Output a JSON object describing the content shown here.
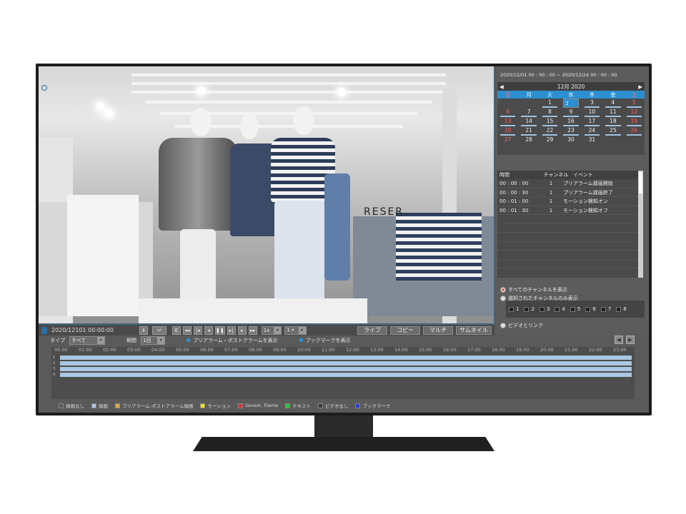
{
  "playback": {
    "datetime": "2020/12101  00:00:00",
    "speed": "1x",
    "step": "1 ⏸",
    "e_label": "E",
    "buttons": [
      "ライブ",
      "コピー",
      "マルチ",
      "サムネイル"
    ]
  },
  "video": {
    "store_sign": "RESER"
  },
  "search_range": "2020/12/01  00 : 00 : 00 ~ 2020/12/24  00 : 00 : 00",
  "calendar": {
    "month_label": "12月  2020",
    "weekdays": [
      "日",
      "月",
      "火",
      "水",
      "木",
      "金",
      "土"
    ],
    "weeks": [
      [
        "",
        "",
        "1",
        "2",
        "3",
        "4",
        "5"
      ],
      [
        "6",
        "7",
        "8",
        "9",
        "10",
        "11",
        "12"
      ],
      [
        "13",
        "14",
        "15",
        "16",
        "17",
        "18",
        "19"
      ],
      [
        "20",
        "21",
        "22",
        "23",
        "24",
        "25",
        "26"
      ],
      [
        "27",
        "28",
        "29",
        "30",
        "31",
        "",
        ""
      ]
    ],
    "selected_day": "2"
  },
  "events": {
    "headers": [
      "時間",
      "チャンネル",
      "イベント"
    ],
    "rows": [
      [
        "00 : 00 : 00",
        "1",
        "プリアラーム録画開始"
      ],
      [
        "00 : 00 : 30",
        "1",
        "プリアラーム録画終了"
      ],
      [
        "00 : 01 : 00",
        "1",
        "モーション検知オン"
      ],
      [
        "00 : 01 : 30",
        "1",
        "モーション検知オフ"
      ]
    ]
  },
  "options": {
    "all_channels": "すべてのチャンネルを表示",
    "selected_channels": "選択されたチャンネルのみ表示",
    "channels": [
      "1",
      "2",
      "3",
      "4",
      "5",
      "6",
      "7",
      "8"
    ],
    "video_link": "ビデオとリンク"
  },
  "timeline": {
    "type_label": "タイプ",
    "type_value": "すべて",
    "period_label": "期間",
    "period_value": "1日",
    "prealarm_check": "プリアラーム・ポストアラームを表示",
    "bookmark_check": "ブックマークを表示",
    "hours": [
      "00:00",
      "01:00",
      "02:00",
      "03:00",
      "04:00",
      "05:00",
      "06:00",
      "07:00",
      "08:00",
      "09:00",
      "10:00",
      "11:00",
      "12:00",
      "13:00",
      "14:00",
      "15:00",
      "16:00",
      "17:00",
      "18:00",
      "19:00",
      "20:00",
      "21:00",
      "22:00",
      "23:00"
    ],
    "channel_count": 4
  },
  "legend": [
    {
      "label": "録画なし",
      "color": "#5a5a5a"
    },
    {
      "label": "録画",
      "color": "#a9c8e3"
    },
    {
      "label": "プリアラーム-ポストアラーム録画",
      "color": "#e6a850"
    },
    {
      "label": "モーション",
      "color": "#f5e600"
    },
    {
      "label": "Sensor, Flame",
      "color": "#e03030"
    },
    {
      "label": "テキスト",
      "color": "#30c030"
    },
    {
      "label": "ビデオなし",
      "color": "#3a3a3a"
    },
    {
      "label": "ブックマーク",
      "color": "#2040d0"
    }
  ]
}
